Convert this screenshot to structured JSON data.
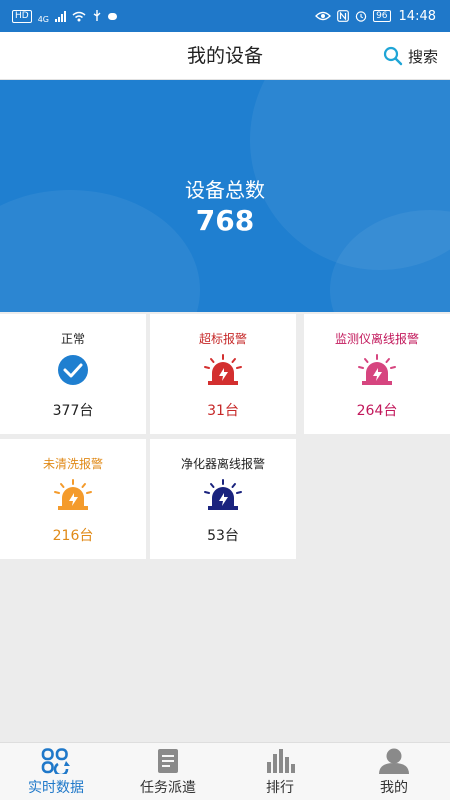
{
  "status_bar": {
    "network_label": "4G",
    "battery": "96",
    "time": "14:48"
  },
  "header": {
    "title": "我的设备",
    "search_label": "搜索"
  },
  "summary": {
    "label": "设备总数",
    "value": "768"
  },
  "cards": [
    {
      "title": "正常",
      "count": "377台",
      "icon": "check-circle-icon",
      "color": "#1f7fd0",
      "text_color": "#222222"
    },
    {
      "title": "超标报警",
      "count": "31台",
      "icon": "alarm-siren-icon",
      "color": "#d32f2f",
      "text_color": "#c62828"
    },
    {
      "title": "监测仪离线报警",
      "count": "264台",
      "icon": "alarm-siren-icon",
      "color": "#d6457f",
      "text_color": "#c2185b"
    },
    {
      "title": "未清洗报警",
      "count": "216台",
      "icon": "alarm-siren-icon",
      "color": "#f49b2c",
      "text_color": "#e08a18"
    },
    {
      "title": "净化器离线报警",
      "count": "53台",
      "icon": "alarm-siren-icon",
      "color": "#1a237e",
      "text_color": "#222222"
    }
  ],
  "tabs": [
    {
      "label": "实时数据",
      "icon": "realtime-grid-icon",
      "active": true
    },
    {
      "label": "任务派遣",
      "icon": "document-icon",
      "active": false
    },
    {
      "label": "排行",
      "icon": "bar-chart-icon",
      "active": false
    },
    {
      "label": "我的",
      "icon": "user-icon",
      "active": false
    }
  ],
  "colors": {
    "primary": "#1f78c9",
    "hero": "#1f7fd0",
    "background": "#ececec",
    "tab_inactive": "#8a8a8a"
  }
}
